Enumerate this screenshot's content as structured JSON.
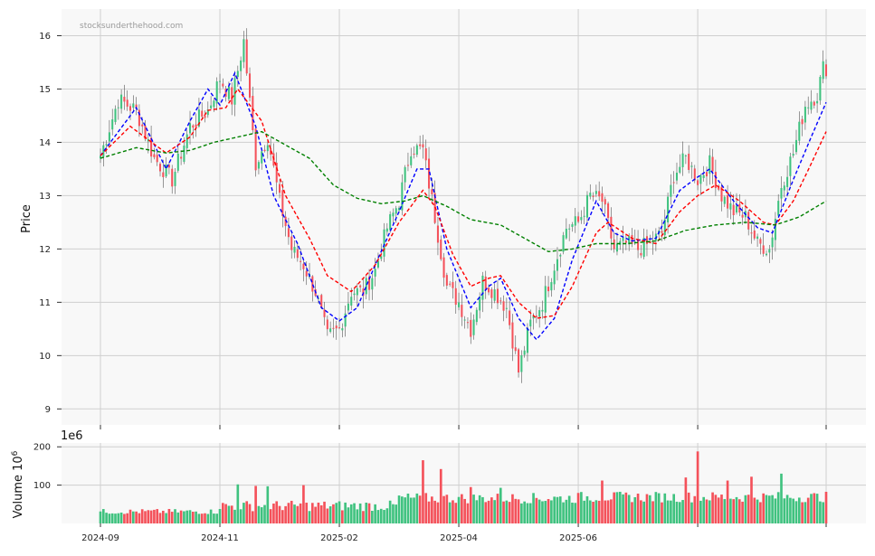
{
  "watermark": "stocksunderthehood.com",
  "colors": {
    "up": "#3fc27f",
    "down": "#f4515a",
    "ma_fast": "#0000ff",
    "ma_mid": "#ff0000",
    "ma_slow": "#008000"
  },
  "chart_data": [
    {
      "type": "candlestick",
      "ylabel": "Price",
      "ylim": [
        8.7,
        16.5
      ],
      "yticks": [
        9,
        10,
        11,
        12,
        13,
        14,
        15,
        16
      ],
      "xticks": [
        "2024-09",
        "2024-11",
        "2025-02",
        "2025-04",
        "2025-06"
      ],
      "grid": true,
      "anchors": [
        {
          "i": 0,
          "v": 13.75
        },
        {
          "i": 6,
          "v": 14.8
        },
        {
          "i": 12,
          "v": 14.6
        },
        {
          "i": 18,
          "v": 13.7
        },
        {
          "i": 24,
          "v": 13.3
        },
        {
          "i": 30,
          "v": 14.3
        },
        {
          "i": 36,
          "v": 14.6
        },
        {
          "i": 40,
          "v": 15.2
        },
        {
          "i": 44,
          "v": 14.8
        },
        {
          "i": 48,
          "v": 15.9
        },
        {
          "i": 52,
          "v": 13.6
        },
        {
          "i": 56,
          "v": 14.1
        },
        {
          "i": 60,
          "v": 12.9
        },
        {
          "i": 64,
          "v": 12.0
        },
        {
          "i": 68,
          "v": 11.7
        },
        {
          "i": 72,
          "v": 11.2
        },
        {
          "i": 76,
          "v": 10.35
        },
        {
          "i": 80,
          "v": 10.5
        },
        {
          "i": 84,
          "v": 11.2
        },
        {
          "i": 88,
          "v": 11.2
        },
        {
          "i": 92,
          "v": 11.6
        },
        {
          "i": 96,
          "v": 12.4
        },
        {
          "i": 100,
          "v": 12.9
        },
        {
          "i": 104,
          "v": 13.9
        },
        {
          "i": 108,
          "v": 13.85
        },
        {
          "i": 112,
          "v": 12.6
        },
        {
          "i": 116,
          "v": 11.3
        },
        {
          "i": 120,
          "v": 11.0
        },
        {
          "i": 124,
          "v": 10.5
        },
        {
          "i": 128,
          "v": 11.4
        },
        {
          "i": 132,
          "v": 11.2
        },
        {
          "i": 136,
          "v": 10.9
        },
        {
          "i": 140,
          "v": 9.7
        },
        {
          "i": 144,
          "v": 10.6
        },
        {
          "i": 148,
          "v": 11.0
        },
        {
          "i": 152,
          "v": 11.7
        },
        {
          "i": 156,
          "v": 12.4
        },
        {
          "i": 160,
          "v": 12.5
        },
        {
          "i": 164,
          "v": 13.0
        },
        {
          "i": 168,
          "v": 12.9
        },
        {
          "i": 172,
          "v": 12.0
        },
        {
          "i": 176,
          "v": 12.1
        },
        {
          "i": 180,
          "v": 12.0
        },
        {
          "i": 184,
          "v": 12.1
        },
        {
          "i": 188,
          "v": 12.3
        },
        {
          "i": 192,
          "v": 13.4
        },
        {
          "i": 196,
          "v": 13.7
        },
        {
          "i": 200,
          "v": 13.3
        },
        {
          "i": 204,
          "v": 13.6
        },
        {
          "i": 208,
          "v": 13.0
        },
        {
          "i": 212,
          "v": 12.7
        },
        {
          "i": 216,
          "v": 12.6
        },
        {
          "i": 220,
          "v": 12.1
        },
        {
          "i": 224,
          "v": 12.0
        },
        {
          "i": 228,
          "v": 13.2
        },
        {
          "i": 232,
          "v": 13.8
        },
        {
          "i": 236,
          "v": 14.7
        },
        {
          "i": 240,
          "v": 14.9
        },
        {
          "i": 242,
          "v": 15.4
        }
      ],
      "moving_averages": [
        {
          "color_key": "ma_fast",
          "points": [
            [
              0,
              13.75
            ],
            [
              12,
              14.65
            ],
            [
              22,
              13.5
            ],
            [
              30,
              14.4
            ],
            [
              36,
              15.0
            ],
            [
              40,
              14.7
            ],
            [
              45,
              15.3
            ],
            [
              52,
              14.3
            ],
            [
              58,
              13.0
            ],
            [
              66,
              12.1
            ],
            [
              74,
              10.9
            ],
            [
              80,
              10.65
            ],
            [
              86,
              10.9
            ],
            [
              92,
              11.7
            ],
            [
              100,
              12.7
            ],
            [
              106,
              13.5
            ],
            [
              110,
              13.5
            ],
            [
              116,
              12.0
            ],
            [
              124,
              10.9
            ],
            [
              130,
              11.3
            ],
            [
              134,
              11.45
            ],
            [
              140,
              10.7
            ],
            [
              146,
              10.3
            ],
            [
              152,
              10.7
            ],
            [
              158,
              11.8
            ],
            [
              166,
              12.9
            ],
            [
              172,
              12.3
            ],
            [
              178,
              12.15
            ],
            [
              186,
              12.2
            ],
            [
              194,
              13.1
            ],
            [
              200,
              13.35
            ],
            [
              204,
              13.5
            ],
            [
              212,
              12.9
            ],
            [
              220,
              12.4
            ],
            [
              225,
              12.3
            ],
            [
              232,
              13.3
            ],
            [
              238,
              14.1
            ],
            [
              243,
              14.75
            ]
          ]
        },
        {
          "color_key": "ma_mid",
          "points": [
            [
              0,
              13.75
            ],
            [
              10,
              14.3
            ],
            [
              22,
              13.8
            ],
            [
              30,
              14.1
            ],
            [
              36,
              14.6
            ],
            [
              42,
              14.65
            ],
            [
              46,
              15.0
            ],
            [
              54,
              14.4
            ],
            [
              62,
              13.0
            ],
            [
              70,
              12.2
            ],
            [
              76,
              11.5
            ],
            [
              84,
              11.2
            ],
            [
              92,
              11.7
            ],
            [
              100,
              12.5
            ],
            [
              108,
              13.1
            ],
            [
              112,
              12.8
            ],
            [
              118,
              11.9
            ],
            [
              124,
              11.3
            ],
            [
              130,
              11.45
            ],
            [
              134,
              11.5
            ],
            [
              140,
              11.0
            ],
            [
              146,
              10.7
            ],
            [
              152,
              10.75
            ],
            [
              158,
              11.3
            ],
            [
              166,
              12.3
            ],
            [
              170,
              12.5
            ],
            [
              178,
              12.2
            ],
            [
              186,
              12.1
            ],
            [
              194,
              12.7
            ],
            [
              200,
              13.0
            ],
            [
              206,
              13.2
            ],
            [
              214,
              12.9
            ],
            [
              222,
              12.5
            ],
            [
              226,
              12.45
            ],
            [
              232,
              12.9
            ],
            [
              238,
              13.6
            ],
            [
              243,
              14.2
            ]
          ]
        },
        {
          "color_key": "ma_slow",
          "points": [
            [
              0,
              13.7
            ],
            [
              12,
              13.9
            ],
            [
              22,
              13.8
            ],
            [
              30,
              13.85
            ],
            [
              38,
              14.0
            ],
            [
              46,
              14.1
            ],
            [
              54,
              14.2
            ],
            [
              62,
              13.95
            ],
            [
              70,
              13.7
            ],
            [
              78,
              13.2
            ],
            [
              86,
              12.95
            ],
            [
              94,
              12.85
            ],
            [
              102,
              12.9
            ],
            [
              108,
              13.0
            ],
            [
              116,
              12.8
            ],
            [
              124,
              12.55
            ],
            [
              134,
              12.45
            ],
            [
              142,
              12.2
            ],
            [
              150,
              11.95
            ],
            [
              158,
              12.0
            ],
            [
              166,
              12.1
            ],
            [
              176,
              12.1
            ],
            [
              186,
              12.15
            ],
            [
              196,
              12.35
            ],
            [
              206,
              12.45
            ],
            [
              216,
              12.5
            ],
            [
              226,
              12.45
            ],
            [
              234,
              12.6
            ],
            [
              243,
              12.9
            ]
          ]
        }
      ]
    },
    {
      "type": "bar",
      "ylabel": "Volume  10",
      "ylabel_exponent": "6",
      "scale_label": "1e6",
      "ylim": [
        0,
        210
      ],
      "yticks": [
        100,
        200
      ],
      "spikes": [
        [
          46,
          102
        ],
        [
          52,
          98
        ],
        [
          56,
          97
        ],
        [
          68,
          100
        ],
        [
          108,
          165
        ],
        [
          114,
          142
        ],
        [
          124,
          95
        ],
        [
          134,
          93
        ],
        [
          168,
          112
        ],
        [
          196,
          120
        ],
        [
          200,
          188
        ],
        [
          210,
          112
        ],
        [
          218,
          122
        ],
        [
          228,
          130
        ]
      ]
    }
  ]
}
